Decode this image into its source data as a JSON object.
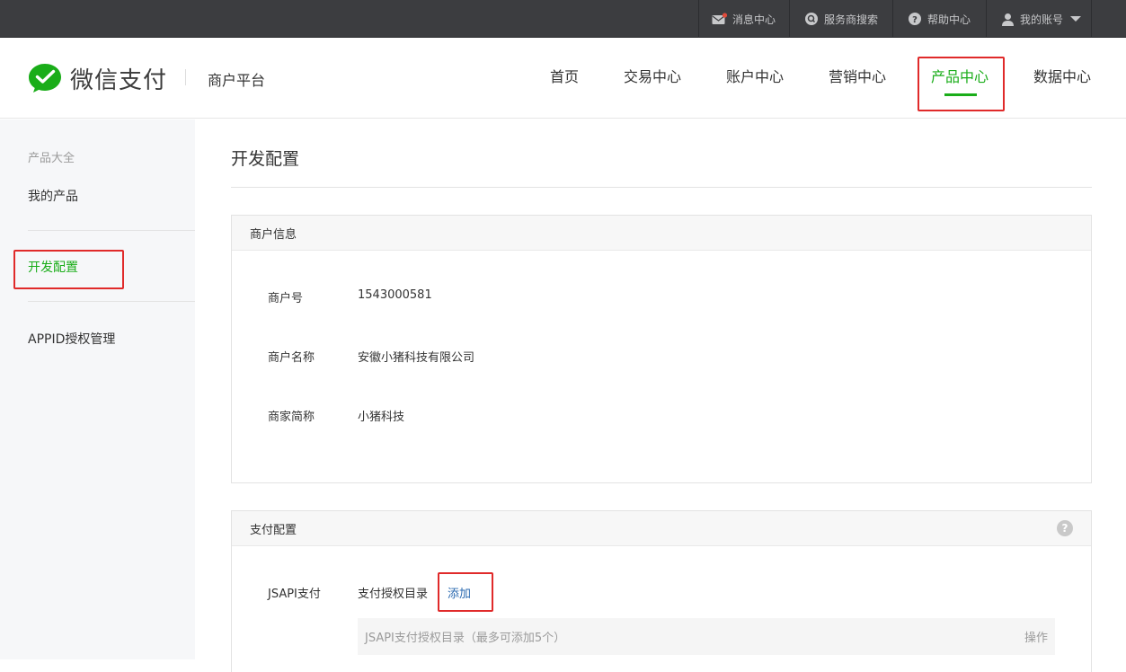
{
  "topbar": {
    "items": [
      {
        "icon": "message-icon",
        "label": "消息中心"
      },
      {
        "icon": "search-circle-icon",
        "label": "服务商搜索"
      },
      {
        "icon": "help-icon",
        "label": "帮助中心"
      },
      {
        "icon": "user-icon",
        "label": "我的账号"
      }
    ],
    "badge_color": "#e14b3b"
  },
  "header": {
    "brand": "微信支付",
    "platform": "商户平台",
    "nav": [
      "首页",
      "交易中心",
      "账户中心",
      "营销中心",
      "产品中心",
      "数据中心"
    ],
    "active_nav": "产品中心",
    "accent_color": "#1aad19"
  },
  "sidebar": {
    "group_label": "产品大全",
    "items": [
      "我的产品",
      "开发配置",
      "APPID授权管理"
    ],
    "active_item": "开发配置"
  },
  "main": {
    "title": "开发配置",
    "merchant_panel": {
      "title": "商户信息",
      "fields": [
        {
          "label": "商户号",
          "value": "1543000581"
        },
        {
          "label": "商户名称",
          "value": "安徽小猪科技有限公司"
        },
        {
          "label": "商家简称",
          "value": "小猪科技"
        }
      ]
    },
    "pay_panel": {
      "title": "支付配置",
      "help": "?",
      "jsapi_label": "JSAPI支付",
      "dir_label": "支付授权目录",
      "add_link": "添加",
      "table": {
        "col_dir": "JSAPI支付授权目录（最多可添加5个）",
        "col_action": "操作"
      }
    }
  }
}
